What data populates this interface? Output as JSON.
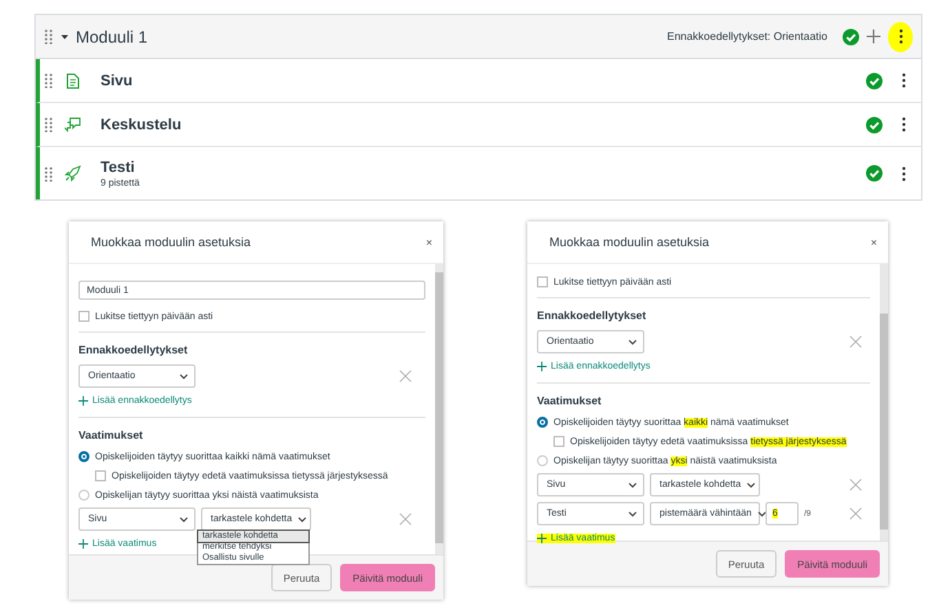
{
  "module": {
    "title": "Moduuli 1",
    "expanded": true,
    "prerequisites_label": "Ennakkoedellytykset: Orientaatio",
    "published": true,
    "menu_highlighted": true,
    "items": [
      {
        "kind": "page",
        "title": "Sivu",
        "published": true
      },
      {
        "kind": "discussion",
        "title": "Keskustelu",
        "published": true
      },
      {
        "kind": "quiz",
        "title": "Testi",
        "subtitle": "9 pistettä",
        "published": true
      }
    ]
  },
  "dialogs": [
    {
      "title": "Muokkaa moduulin asetuksia",
      "close": "×",
      "name_value": "Moduuli 1",
      "lock": {
        "label": "Lukitse tiettyyn päivään asti",
        "checked": false
      },
      "prerequisites_heading": "Ennakkoedellytykset",
      "prerequisites": [
        {
          "value": "Orientaatio"
        }
      ],
      "add_prerequisite": "Lisää ennakkoedellytys",
      "requirements_heading": "Vaatimukset",
      "options": [
        {
          "kind": "radio",
          "selected": true,
          "label": [
            {
              "text": "Opiskelijoiden täytyy suorittaa kaikki nämä vaatimukset",
              "highlighted": false
            }
          ]
        },
        {
          "kind": "checkbox",
          "checked": false,
          "label": [
            {
              "text": "Opiskelijoiden täytyy edetä vaatimuksissa tietyssä järjestyksessä",
              "highlighted": false
            }
          ]
        },
        {
          "kind": "radio",
          "selected": false,
          "label": [
            {
              "text": "Opiskelijan täytyy suorittaa yksi näistä vaatimuksista",
              "highlighted": false
            }
          ]
        }
      ],
      "requirements": [
        {
          "item": "Sivu",
          "action": "tarkastele kohdetta",
          "menu": [
            {
              "label": "tarkastele kohdetta",
              "selected": true
            },
            {
              "label": "merkitse tehdyksi",
              "selected": false
            },
            {
              "label": "Osallistu sivulle",
              "selected": false
            }
          ]
        }
      ],
      "add_requirement": {
        "text": "Lisää vaatimus",
        "highlighted": false
      },
      "buttons": [
        {
          "label": "Peruuta",
          "kind": "secondary"
        },
        {
          "label": "Päivitä moduuli",
          "kind": "primary"
        }
      ]
    },
    {
      "title": "Muokkaa moduulin asetuksia",
      "close": "×",
      "lock": {
        "label": "Lukitse tiettyyn päivään asti",
        "checked": false
      },
      "prerequisites_heading": "Ennakkoedellytykset",
      "prerequisites": [
        {
          "value": "Orientaatio"
        }
      ],
      "add_prerequisite": "Lisää ennakkoedellytys",
      "requirements_heading": "Vaatimukset",
      "options": [
        {
          "kind": "radio",
          "selected": true,
          "label": [
            {
              "text": "Opiskelijoiden täytyy suorittaa ",
              "highlighted": false
            },
            {
              "text": "kaikki",
              "highlighted": true
            },
            {
              "text": " nämä vaatimukset",
              "highlighted": false
            }
          ]
        },
        {
          "kind": "checkbox",
          "checked": false,
          "label": [
            {
              "text": "Opiskelijoiden täytyy edetä vaatimuksissa ",
              "highlighted": false
            },
            {
              "text": "tietyssä järjestyksessä",
              "highlighted": true
            }
          ]
        },
        {
          "kind": "radio",
          "selected": false,
          "label": [
            {
              "text": "Opiskelijan täytyy suorittaa ",
              "highlighted": false
            },
            {
              "text": "yksi",
              "highlighted": true
            },
            {
              "text": " näistä vaatimuksista",
              "highlighted": false
            }
          ]
        }
      ],
      "requirements": [
        {
          "item": "Sivu",
          "action": "tarkastele kohdetta"
        },
        {
          "item": "Testi",
          "action": "pistemäärä vähintään",
          "score": {
            "value": "6",
            "highlighted": true
          },
          "max": "/9"
        }
      ],
      "add_requirement": {
        "text": "Lisää vaatimus",
        "highlighted": true
      },
      "buttons": [
        {
          "label": "Peruuta",
          "kind": "secondary"
        },
        {
          "label": "Päivitä moduuli",
          "kind": "primary"
        }
      ]
    }
  ]
}
